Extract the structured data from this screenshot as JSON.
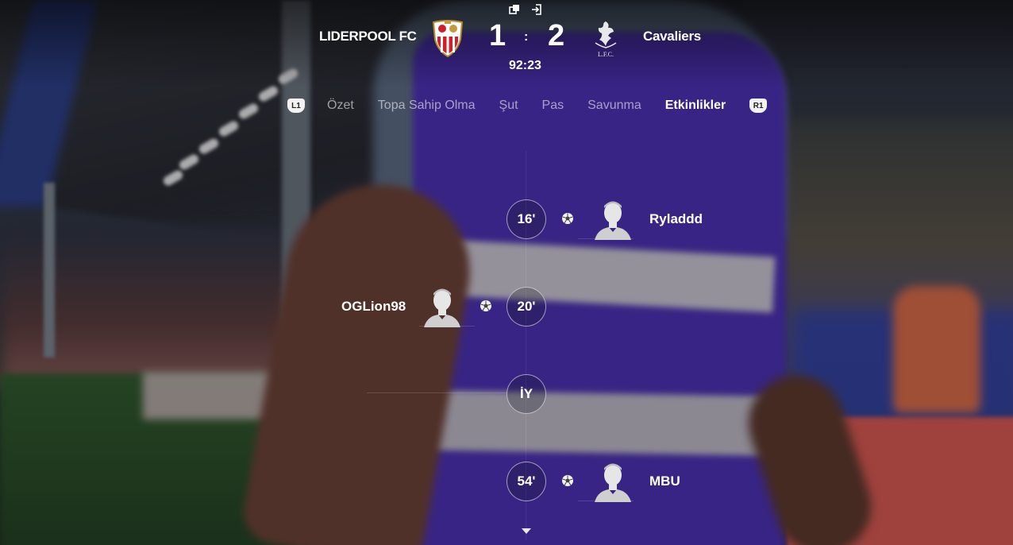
{
  "top_icons": [
    "window-switch-icon",
    "exit-icon"
  ],
  "match": {
    "home": {
      "name": "LIDERPOOL FC",
      "score": "1",
      "crest": "sevilla-crest-icon"
    },
    "away": {
      "name": "Cavaliers",
      "score": "2",
      "crest": "liverpool-crest-icon",
      "crest_text": "L.F.C."
    },
    "separator": ":",
    "clock": "92:23"
  },
  "tabs": {
    "left_button": "L1",
    "right_button": "R1",
    "items": [
      "Özet",
      "Topa Sahip Olma",
      "Şut",
      "Pas",
      "Savunma",
      "Etkinlikler"
    ],
    "active": "Etkinlikler"
  },
  "events": [
    {
      "minute": "16'",
      "side": "right",
      "type": "goal",
      "icon": "soccer-ball-icon",
      "player": "Ryladdd"
    },
    {
      "minute": "20'",
      "side": "left",
      "type": "goal",
      "icon": "soccer-ball-icon",
      "player": "OGLion98"
    },
    {
      "minute": "İY",
      "side": "center",
      "type": "half-time"
    },
    {
      "minute": "54'",
      "side": "right",
      "type": "goal",
      "icon": "soccer-ball-icon",
      "player": "MBU"
    }
  ],
  "scroll_indicator": "chevron-down-icon",
  "colors": {
    "text": "#ffffff",
    "inactive_tab": "#bdbdc4",
    "button_pad": "#f2f2f2"
  }
}
